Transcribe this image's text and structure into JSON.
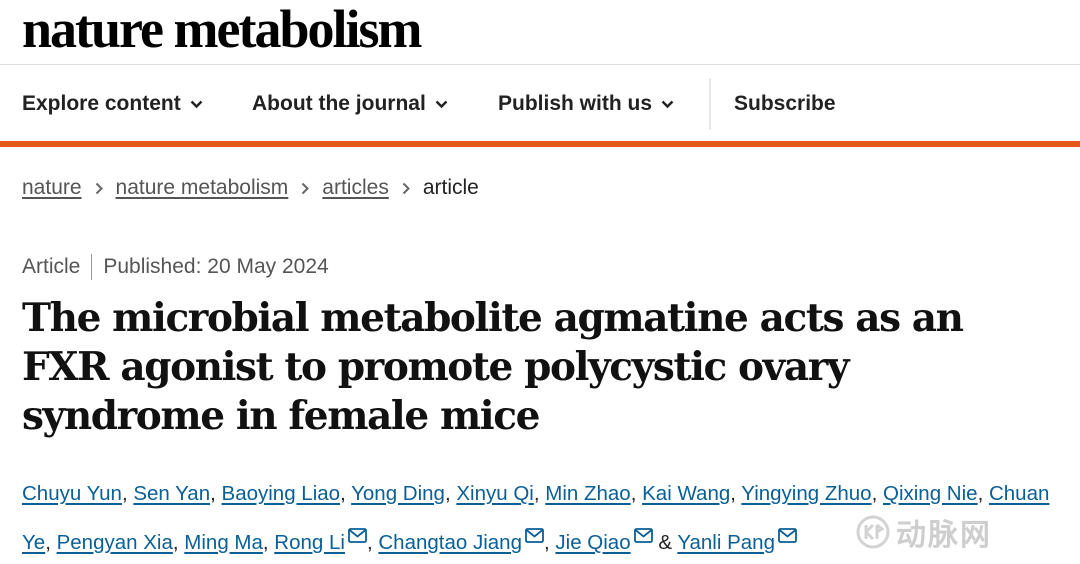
{
  "site": {
    "logo": "nature metabolism"
  },
  "nav": {
    "items": [
      {
        "label": "Explore content",
        "dropdown": true
      },
      {
        "label": "About the journal",
        "dropdown": true
      },
      {
        "label": "Publish with us",
        "dropdown": true
      },
      {
        "label": "Subscribe",
        "dropdown": false
      }
    ]
  },
  "breadcrumb": {
    "items": [
      "nature",
      "nature metabolism",
      "articles"
    ],
    "current": "article"
  },
  "article": {
    "type": "Article",
    "published": "Published: 20 May 2024",
    "title": "The microbial metabolite agmatine acts as an FXR agonist to promote polycystic ovary syndrome in female mice",
    "authors": [
      {
        "name": "Chuyu Yun",
        "email": false
      },
      {
        "name": "Sen Yan",
        "email": false
      },
      {
        "name": "Baoying Liao",
        "email": false
      },
      {
        "name": "Yong Ding",
        "email": false
      },
      {
        "name": "Xinyu Qi",
        "email": false
      },
      {
        "name": "Min Zhao",
        "email": false
      },
      {
        "name": "Kai Wang",
        "email": false
      },
      {
        "name": "Yingying Zhuo",
        "email": false
      },
      {
        "name": "Qixing Nie",
        "email": false
      },
      {
        "name": "Chuan Ye",
        "email": false
      },
      {
        "name": "Pengyan Xia",
        "email": false
      },
      {
        "name": "Ming Ma",
        "email": false
      },
      {
        "name": "Rong Li",
        "email": true
      },
      {
        "name": "Changtao Jiang",
        "email": true
      },
      {
        "name": "Jie Qiao",
        "email": true
      },
      {
        "name": "Yanli Pang",
        "email": true
      }
    ],
    "author_last_separator": "&"
  },
  "watermark": {
    "text": "动脉网"
  },
  "colors": {
    "accent": "#e5571d",
    "link": "#0a5f96"
  },
  "icons": {
    "dropdown": "chevron-down-icon",
    "breadcrumb_sep": "chevron-right-icon",
    "email": "envelope-icon"
  }
}
